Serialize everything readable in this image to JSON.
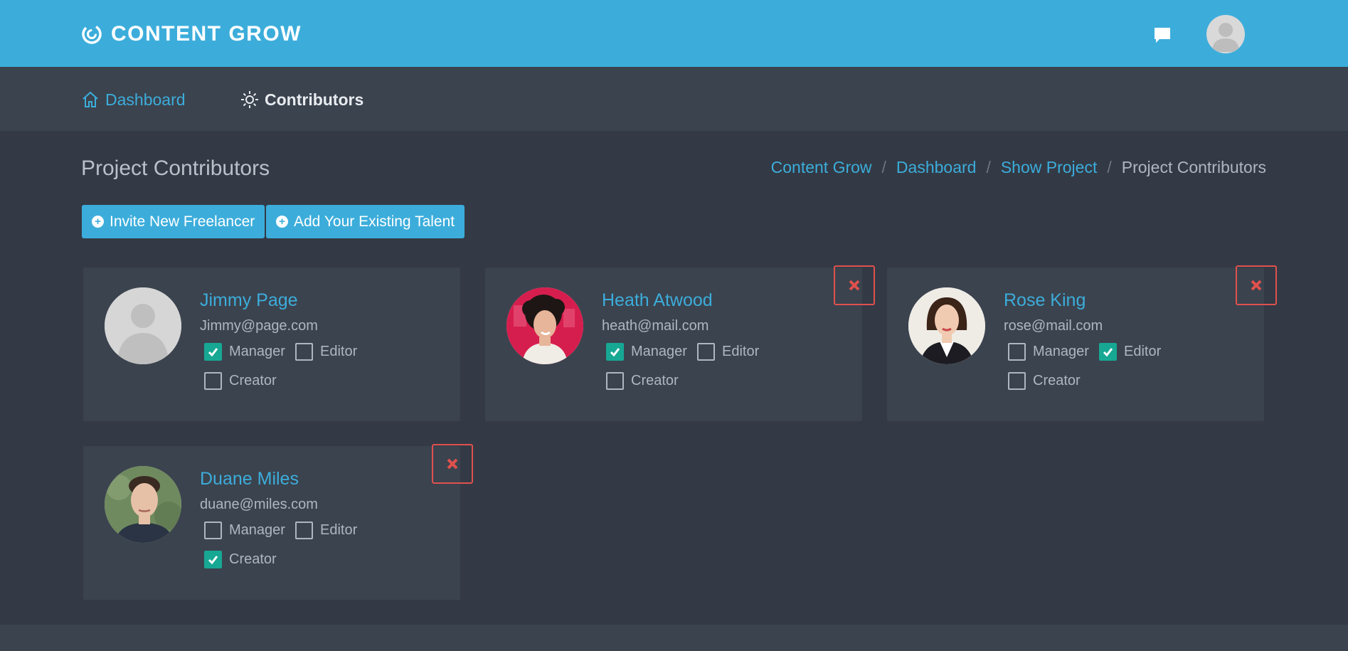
{
  "header": {
    "brand": "CONTENT GROW",
    "brand_color": "#3caddb",
    "icons": [
      "swirl-logo-icon",
      "chat-icon",
      "user-avatar-icon"
    ]
  },
  "nav": {
    "dashboard_label": "Dashboard",
    "contributors_label": "Contributors"
  },
  "page": {
    "title": "Project Contributors",
    "breadcrumb": [
      "Content Grow",
      "Dashboard",
      "Show Project",
      "Project Contributors"
    ]
  },
  "actions": {
    "invite_label": "Invite New Freelancer",
    "add_label": "Add Your Existing Talent"
  },
  "role_labels": {
    "manager": "Manager",
    "editor": "Editor",
    "creator": "Creator"
  },
  "contributors": [
    {
      "name": "Jimmy Page",
      "email": "Jimmy@page.com",
      "manager": true,
      "editor": false,
      "creator": false,
      "removable": false,
      "avatar": "placeholder-avatar"
    },
    {
      "name": "Heath Atwood",
      "email": "heath@mail.com",
      "manager": true,
      "editor": false,
      "creator": false,
      "removable": true,
      "avatar": "photo-woman-curly-hair"
    },
    {
      "name": "Rose King",
      "email": "rose@mail.com",
      "manager": false,
      "editor": true,
      "creator": false,
      "removable": true,
      "avatar": "photo-woman-dark-hair"
    },
    {
      "name": "Duane Miles",
      "email": "duane@miles.com",
      "manager": false,
      "editor": false,
      "creator": true,
      "removable": true,
      "avatar": "photo-man-short-hair"
    }
  ],
  "colors": {
    "background": "#333a45",
    "card": "#3b434e",
    "accent": "#3caddb",
    "checked": "#17a894",
    "danger": "#e0514d"
  }
}
